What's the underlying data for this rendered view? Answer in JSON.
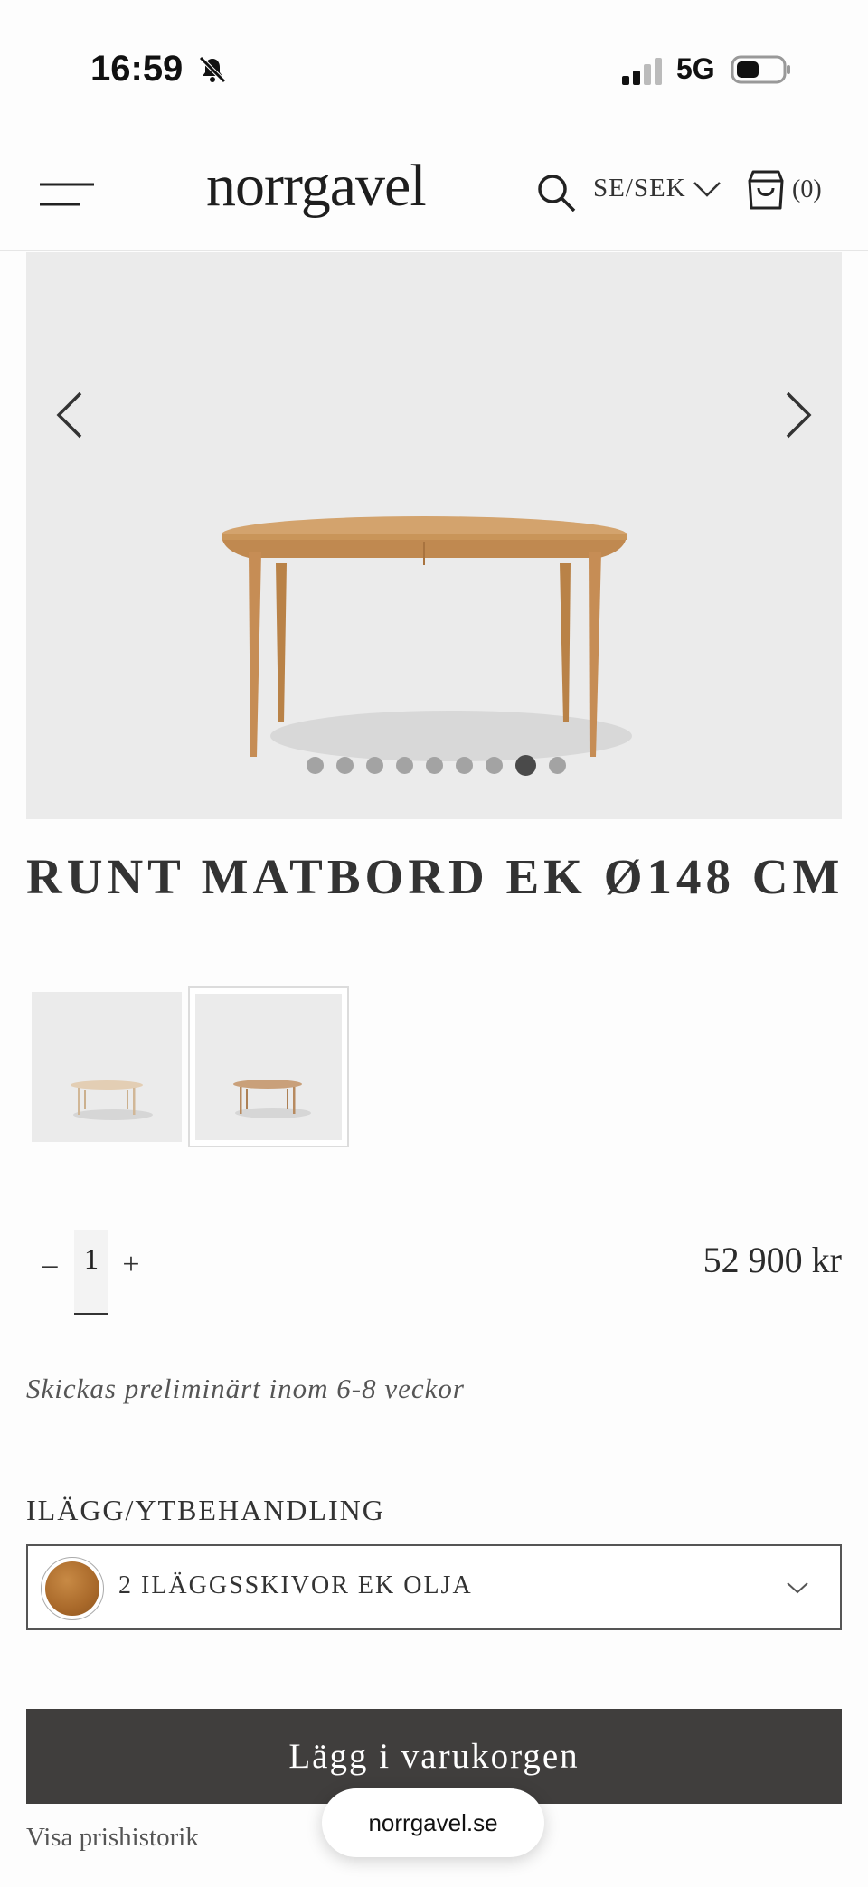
{
  "status_bar": {
    "time": "16:59",
    "network": "5G"
  },
  "header": {
    "logo": "norrgavel",
    "locale": "SE/SEK",
    "cart_count": "(0)"
  },
  "gallery": {
    "dot_count": 9,
    "active_index": 7
  },
  "product": {
    "title": "RUNT MATBORD EK Ø148 CM",
    "quantity": "1",
    "qty_minus": "–",
    "qty_plus": "+",
    "price": "52 900 kr",
    "shipping_note": "Skickas preliminärt inom 6-8 veckor",
    "option_label": "ILÄGG/YTBEHANDLING",
    "option_value": "2 ILÄGGSSKIVOR EK OLJA",
    "add_to_cart_label": "Lägg i varukorgen",
    "price_history_link": "Visa prishistorik"
  },
  "browser": {
    "url": "norrgavel.se"
  },
  "colors": {
    "button_bg": "#403e3d",
    "hero_bg": "#ebebeb",
    "wood": "#c88a45"
  }
}
